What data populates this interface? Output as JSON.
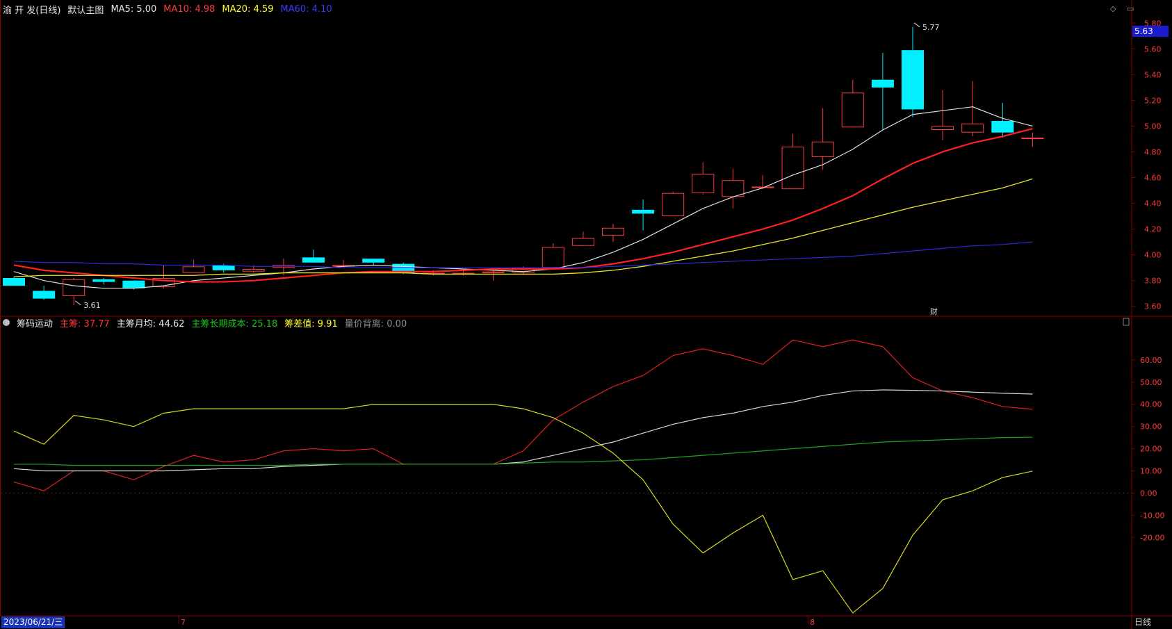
{
  "title_bar": {
    "name": "渝 开 发(日线)",
    "indicator": "默认主图",
    "ma5_label": "MA5:",
    "ma5_val": "5.00",
    "ma10_label": "MA10:",
    "ma10_val": "4.98",
    "ma20_label": "MA20:",
    "ma20_val": "4.59",
    "ma60_label": "MA60:",
    "ma60_val": "4.10"
  },
  "sub_bar": {
    "name": "筹码运动",
    "main_label": "主筹:",
    "main_val": "37.77",
    "month_label": "主筹月均:",
    "month_val": "44.62",
    "long_label": "主筹长期成本:",
    "long_val": "25.18",
    "diff_label": "筹差值:",
    "diff_val": "9.91",
    "vol_label": "量价背离:",
    "vol_val": "0.00"
  },
  "last_price": "5.63",
  "date_label": "2023/06/21/三",
  "period_label": "日线",
  "fin_marker": "财",
  "corner_icons": "◇ ▭",
  "colors": {
    "up": "#ff3b3b",
    "down": "#00f0ff",
    "ma5": "#e0e0e0",
    "ma10": "#ff2020",
    "ma20": "#e8e820",
    "ma60": "#2a2ad8",
    "axis": "#8b0000",
    "main": "#e02020",
    "month": "#d8d8d8",
    "long": "#1fa51f",
    "diff": "#d8d820"
  },
  "chart_data": {
    "main": {
      "type": "candlestick",
      "y_axis_ticks": [
        "5.80",
        "5.60",
        "5.40",
        "5.20",
        "5.00",
        "4.80",
        "4.60",
        "4.40",
        "4.20",
        "4.00",
        "3.80",
        "3.60"
      ],
      "ylim": [
        3.55,
        5.85
      ],
      "x_ticks": [
        {
          "index": 6,
          "label": "7"
        },
        {
          "index": 27,
          "label": "8"
        }
      ],
      "annotations": [
        {
          "index": 30,
          "value": 5.77,
          "text": "5.77"
        },
        {
          "index": 2,
          "value": 3.61,
          "text": "3.61"
        }
      ],
      "candles": [
        {
          "o": 3.82,
          "c": 3.76,
          "h": 3.83,
          "l": 3.76
        },
        {
          "o": 3.72,
          "c": 3.66,
          "h": 3.76,
          "l": 3.65
        },
        {
          "o": 3.68,
          "c": 3.81,
          "h": 3.82,
          "l": 3.61
        },
        {
          "o": 3.81,
          "c": 3.79,
          "h": 3.82,
          "l": 3.77
        },
        {
          "o": 3.8,
          "c": 3.74,
          "h": 3.8,
          "l": 3.73
        },
        {
          "o": 3.75,
          "c": 3.82,
          "h": 3.92,
          "l": 3.74
        },
        {
          "o": 3.86,
          "c": 3.91,
          "h": 3.96,
          "l": 3.86
        },
        {
          "o": 3.92,
          "c": 3.88,
          "h": 3.93,
          "l": 3.86
        },
        {
          "o": 3.87,
          "c": 3.89,
          "h": 3.92,
          "l": 3.86
        },
        {
          "o": 3.9,
          "c": 3.92,
          "h": 3.97,
          "l": 3.84
        },
        {
          "o": 3.98,
          "c": 3.94,
          "h": 4.04,
          "l": 3.94
        },
        {
          "o": 3.91,
          "c": 3.92,
          "h": 3.96,
          "l": 3.9
        },
        {
          "o": 3.97,
          "c": 3.94,
          "h": 3.97,
          "l": 3.92
        },
        {
          "o": 3.93,
          "c": 3.86,
          "h": 3.94,
          "l": 3.85
        },
        {
          "o": 3.85,
          "c": 3.86,
          "h": 3.88,
          "l": 3.84
        },
        {
          "o": 3.85,
          "c": 3.86,
          "h": 3.88,
          "l": 3.84
        },
        {
          "o": 3.86,
          "c": 3.87,
          "h": 3.88,
          "l": 3.8
        },
        {
          "o": 3.86,
          "c": 3.9,
          "h": 3.91,
          "l": 3.85
        },
        {
          "o": 3.9,
          "c": 4.06,
          "h": 4.09,
          "l": 3.89
        },
        {
          "o": 4.07,
          "c": 4.13,
          "h": 4.18,
          "l": 4.07
        },
        {
          "o": 4.15,
          "c": 4.21,
          "h": 4.24,
          "l": 4.1
        },
        {
          "o": 4.35,
          "c": 4.32,
          "h": 4.43,
          "l": 4.19
        },
        {
          "o": 4.3,
          "c": 4.48,
          "h": 4.49,
          "l": 4.3
        },
        {
          "o": 4.48,
          "c": 4.63,
          "h": 4.72,
          "l": 4.47
        },
        {
          "o": 4.45,
          "c": 4.58,
          "h": 4.67,
          "l": 4.36
        },
        {
          "o": 4.52,
          "c": 4.53,
          "h": 4.62,
          "l": 4.51
        },
        {
          "o": 4.51,
          "c": 4.84,
          "h": 4.94,
          "l": 4.51
        },
        {
          "o": 4.76,
          "c": 4.88,
          "h": 5.14,
          "l": 4.66
        },
        {
          "o": 4.99,
          "c": 5.26,
          "h": 5.36,
          "l": 4.99
        },
        {
          "o": 5.36,
          "c": 5.3,
          "h": 5.57,
          "l": 4.97
        },
        {
          "o": 5.59,
          "c": 5.13,
          "h": 5.77,
          "l": 5.07
        },
        {
          "o": 4.97,
          "c": 5.0,
          "h": 5.28,
          "l": 4.89
        },
        {
          "o": 4.95,
          "c": 5.02,
          "h": 5.35,
          "l": 4.92
        },
        {
          "o": 5.04,
          "c": 4.95,
          "h": 5.18,
          "l": 4.91
        },
        {
          "o": 4.91,
          "c": 4.91,
          "h": 4.95,
          "l": 4.84
        }
      ],
      "series": [
        {
          "name": "MA5",
          "values": [
            3.87,
            3.8,
            3.76,
            3.74,
            3.74,
            3.76,
            3.8,
            3.82,
            3.84,
            3.86,
            3.89,
            3.91,
            3.92,
            3.91,
            3.9,
            3.89,
            3.88,
            3.87,
            3.89,
            3.94,
            4.02,
            4.12,
            4.24,
            4.36,
            4.45,
            4.52,
            4.62,
            4.7,
            4.82,
            4.97,
            5.09,
            5.12,
            5.15,
            5.06,
            5.0
          ]
        },
        {
          "name": "MA10",
          "values": [
            3.92,
            3.88,
            3.86,
            3.84,
            3.82,
            3.8,
            3.79,
            3.79,
            3.8,
            3.82,
            3.84,
            3.86,
            3.87,
            3.87,
            3.87,
            3.88,
            3.89,
            3.89,
            3.89,
            3.9,
            3.93,
            3.97,
            4.02,
            4.08,
            4.14,
            4.2,
            4.27,
            4.36,
            4.46,
            4.59,
            4.71,
            4.8,
            4.87,
            4.92,
            4.98
          ]
        },
        {
          "name": "MA20",
          "values": [
            3.83,
            3.84,
            3.84,
            3.84,
            3.84,
            3.84,
            3.84,
            3.85,
            3.85,
            3.86,
            3.86,
            3.86,
            3.86,
            3.86,
            3.85,
            3.85,
            3.85,
            3.85,
            3.85,
            3.86,
            3.88,
            3.91,
            3.95,
            3.99,
            4.03,
            4.08,
            4.13,
            4.19,
            4.25,
            4.31,
            4.37,
            4.42,
            4.47,
            4.52,
            4.59
          ]
        },
        {
          "name": "MA60",
          "values": [
            3.95,
            3.94,
            3.94,
            3.93,
            3.93,
            3.92,
            3.92,
            3.92,
            3.91,
            3.91,
            3.91,
            3.9,
            3.9,
            3.9,
            3.9,
            3.9,
            3.9,
            3.9,
            3.9,
            3.9,
            3.91,
            3.92,
            3.93,
            3.94,
            3.95,
            3.96,
            3.97,
            3.98,
            3.99,
            4.01,
            4.03,
            4.05,
            4.07,
            4.08,
            4.1
          ]
        }
      ]
    },
    "sub": {
      "type": "line",
      "y_axis_ticks": [
        "60.00",
        "50.00",
        "40.00",
        "30.00",
        "20.00",
        "10.00",
        "0.00",
        "-10.00",
        "-20.00"
      ],
      "ylim": [
        -55,
        75
      ],
      "series": [
        {
          "name": "主筹",
          "values": [
            5,
            1,
            10,
            10,
            6,
            12,
            17,
            14,
            15,
            19,
            20,
            19,
            20,
            13,
            13,
            13,
            13,
            19,
            33,
            41,
            48,
            53,
            62,
            65,
            62,
            58,
            69,
            66,
            69,
            66,
            52,
            46,
            43,
            39,
            37.77
          ]
        },
        {
          "name": "主筹月均",
          "values": [
            11,
            10,
            10,
            10,
            10,
            10,
            10.5,
            11,
            11,
            12,
            12.5,
            13,
            13,
            13,
            13,
            13,
            13,
            14,
            17,
            20,
            23,
            27,
            31,
            34,
            36,
            39,
            41,
            44,
            46,
            46.5,
            46.3,
            46,
            45.5,
            45,
            44.62
          ]
        },
        {
          "name": "主筹长期成本",
          "values": [
            13,
            13,
            12.5,
            12.5,
            12.5,
            12.5,
            12.5,
            12.5,
            12.5,
            12.5,
            13,
            13,
            13,
            13,
            13,
            13,
            13,
            13.5,
            14,
            14,
            14.5,
            15,
            16,
            17,
            18,
            19,
            20,
            21,
            22,
            23,
            23.5,
            24,
            24.5,
            25,
            25.18
          ]
        },
        {
          "name": "筹差值",
          "values": [
            28,
            22,
            35,
            33,
            30,
            36,
            38,
            38,
            38,
            38,
            38,
            38,
            40,
            40,
            40,
            40,
            40,
            38,
            34,
            27,
            18,
            6,
            -14,
            -27,
            -18,
            -10,
            -39,
            -35,
            -54,
            -43,
            -19,
            -3,
            1,
            7,
            9.91
          ]
        }
      ]
    }
  }
}
